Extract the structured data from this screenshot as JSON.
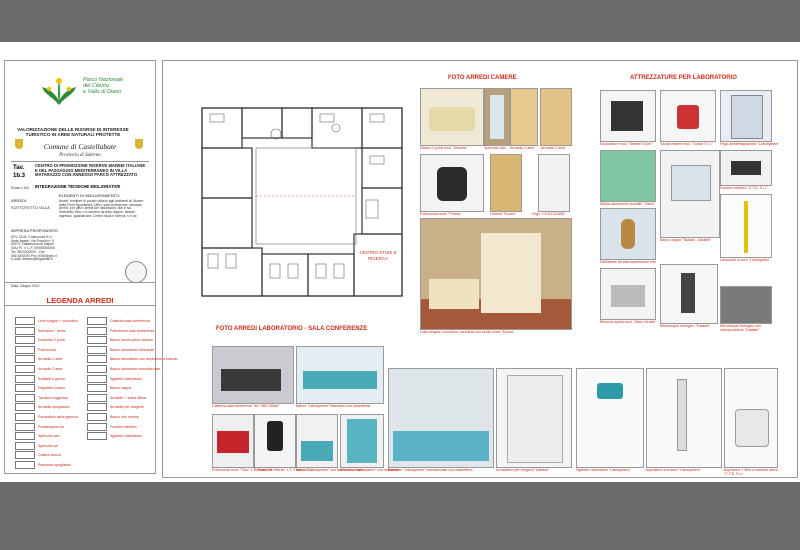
{
  "title_block": {
    "park_name": [
      "Parco Nazionale",
      "del Cilento",
      "e Vallo di Diano"
    ],
    "project_title": "VALORIZZAZIONE DELLE RISORSE DI INTERESSE TURISTICO IN AREE NATURALI PROTETTE",
    "comune": "Comune di Castellabate",
    "provincia": "Provincia di Salerno",
    "tav_label": "Tav.",
    "tav_number": "1b.3",
    "centro": "CENTRO DI PROMOZIONE RISERVE MARINE ITALIANE E DEL PASSAGGIO MEDITERRANEO IN VILLA MATARAZZO CON ANNESSO PARCO ATTREZZATO",
    "scale": "Scala 1:100",
    "integrazione": "INTEGRAZIONE TECNICHE MIGLIORATIVE",
    "arredi": "ARREDI:",
    "piano": "SOTTOTETTO VILLA",
    "elementi_title": "ELEMENTI DI MIGLIORAMENTO:",
    "elementi_text": "Arredi: forniture di pronto utilizzo agli ambienti di: Museo della Flora Spontanea, Uffici, sala conferenze, sbarque; Arredi: per uffici; arredi per laboratorio; Bar e sa.; Sottotetto Villa: n.4 camere da letto doppie, sedute, ingresso, guardaroba; Centro studi e ricerca; n.9 wc",
    "impresa_label": "IMPRESA PROPONENTE:",
    "impresa_text": "DEL.TA.M. Costruzioni S.r.l. Sede legale: Via Puccini n. 9 84073 Casalbuono di Napoli (SA) P.I. e C.F. 00000000000 Tel. 0810000000 - Fax 0810000000 Pec 0000@pec.it e-mail: delcem@legalmail.it",
    "data": "Data: Giugno 2010"
  },
  "legend": {
    "title": "LEGENDA ARREDI",
    "left": [
      "Letto singolo + comodino",
      "Scrivania + sedia",
      "Divanetto 2 posti",
      "Poltroncina",
      "Armadio 2 ante",
      "Armadio 3 ante",
      "Scaffale a giorno",
      "Frigorifero basso",
      "Tavolino soggiorno",
      "Armadio spogliatoio",
      "Portarotolo carta igienica",
      "Portascopino wc",
      "Specchio alto",
      "Specchio wc",
      "Cabina doccia",
      "Panchina spogliatoio"
    ],
    "right": [
      "Cattedra sala conferenze",
      "Poltroncine sala conferenze",
      "Banco tavolo piano acciaio",
      "Banco laboratorio bifacciale",
      "Banco laboratorio con aspiratore a braccio",
      "Banco laboratorio monofacciale",
      "Sgabello laboratorio",
      "Banco cappa",
      "Armadio + sedia ufficio",
      "Armadio per reagenti",
      "Banco con vetrina",
      "Fornello elettrico",
      "Sgabello laboratorio"
    ]
  },
  "floorplan": {
    "room_label_1": "CENTRO STUDI E",
    "room_label_2": "RICERCA"
  },
  "section_camere": {
    "title": "FOTO ARREDI CAMERE",
    "captions": [
      "Divano 2 posti mod. \"Moneta\"",
      "Specchio alto",
      "Armadio 3 ante",
      "Armadio 2 ante",
      "Poltroncina mod. \"Florida\"",
      "Libreria \"Epoca\"",
      "Frigo \"LS-DC101BA\"",
      "Letto singolo, comodino, scrivania con sedia Linea \"Epoca\""
    ]
  },
  "section_lab": {
    "title": "ATTREZZATURE PER LABORATORIO",
    "captions": [
      "Essiccatore mod. \"Stream Dryer\"",
      "Tavola esame mod. \"Dobar S.r.l.\"",
      "Frigo antideflagrazione \"Labosystem\"",
      "Mulino laboratorio portatile \"Sibiol\"",
      "Banco cappa \"Taaliati - Dataleb\"",
      "Fornello elettrico \"C.T.B. S.r.l.\"",
      "Distillatore ad alta separazione e/fs",
      "Lavaocchi a torre \"Labosystem\"",
      "Bilancia rapida mod. \"Micro Grade\"",
      "Microscopio biologico \"Dataleb\"",
      "Microscopio biologico con videoproiettore \"Dataleb\""
    ]
  },
  "section_conf": {
    "title": "FOTO ARREDI LABORATORIO - SALA CONFERENZE",
    "captions": [
      "Cattedra sala conferenze \"art. 988 i Mitari\"",
      "Banco \"Labosystem\" bifacciale con cassettiera",
      "Poltroncine mod. \"Sirio\" L.T. Form 2 S.r.l.",
      "Poltrona dir. \"Miran\" L.T. Form 2 S.r.l.",
      "Banco \"Labosystem\" con lavello in acciaio",
      "Armadio \"Labosystem\" con vetrinette",
      "Bancone \"Labosystem\" monofacciale con cassettiera",
      "Armadietto per reagenti \"Dataleb\"",
      "Sgabello laboratorio \"Labosystem\"",
      "Aspiratore a braccio \"Labosystem\"",
      "Aspiratore + filtro a carbone attivo \"C.T.B. S.r.l.\""
    ]
  },
  "colors": {
    "background": "#6b6b6b",
    "accent_red": "#cc2a18",
    "park_green": "#2e8b3a"
  }
}
